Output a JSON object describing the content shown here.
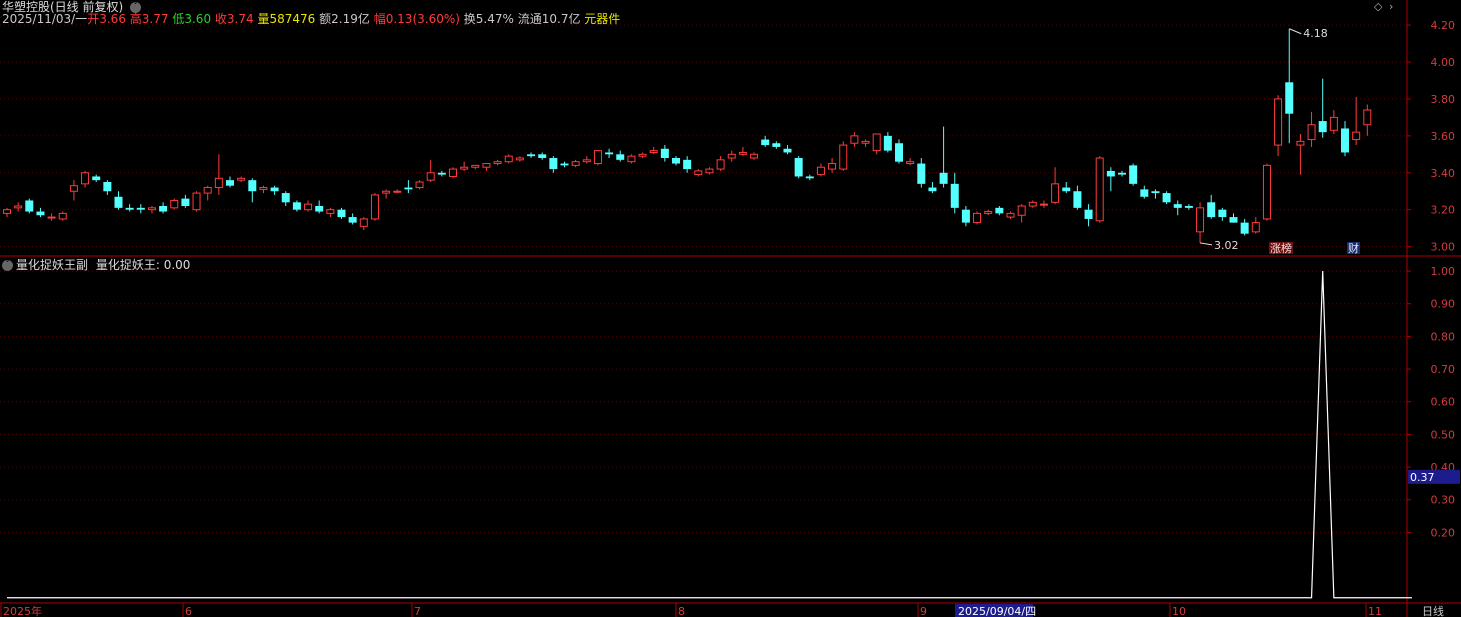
{
  "header": {
    "title": "华塑控股(日线 前复权)",
    "date": "2025/11/03/一",
    "open_label": "开",
    "open": "3.66",
    "high_label": "高",
    "high": "3.77",
    "low_label": "低",
    "low": "3.60",
    "close_label": "收",
    "close": "3.74",
    "vol_label": "量",
    "vol": "587476",
    "amt_label": "额",
    "amt": "2.19亿",
    "chg_label": "幅",
    "chg": "0.13(3.60%)",
    "turn_label": "换",
    "turn": "5.47%",
    "float_label": "流通",
    "float": "10.7亿",
    "sector": "元器件"
  },
  "indicator": {
    "title": "量化捉妖王副",
    "line_label": "量化捉妖王",
    "value": "0.00",
    "cursor_value": "0.37"
  },
  "badges": {
    "zhangting": "涨榜",
    "cai": "财"
  },
  "extremes": {
    "high_label": "4.18",
    "low_label": "3.02"
  },
  "footer": {
    "period": "日线",
    "cursor_date": "2025/09/04/四",
    "x_labels": [
      "2025年",
      "6",
      "7",
      "8",
      "9",
      "10",
      "11"
    ]
  },
  "colors": {
    "up": "#ff3b3b",
    "down": "#54ffff",
    "axis": "#b00000",
    "grid": "#5a0000",
    "text": "#c8c8c8"
  },
  "chart_data": [
    {
      "type": "candlestick",
      "y_ticks": [
        "3.00",
        "3.20",
        "3.40",
        "3.60",
        "3.80",
        "4.00",
        "4.20"
      ],
      "ylim": [
        2.96,
        4.26
      ],
      "candles": [
        [
          3.18,
          3.21,
          3.16,
          3.2
        ],
        [
          3.21,
          3.24,
          3.19,
          3.22
        ],
        [
          3.25,
          3.26,
          3.18,
          3.19
        ],
        [
          3.19,
          3.21,
          3.16,
          3.17
        ],
        [
          3.16,
          3.18,
          3.14,
          3.16
        ],
        [
          3.15,
          3.19,
          3.14,
          3.18
        ],
        [
          3.3,
          3.36,
          3.25,
          3.33
        ],
        [
          3.34,
          3.41,
          3.32,
          3.4
        ],
        [
          3.38,
          3.39,
          3.35,
          3.36
        ],
        [
          3.35,
          3.36,
          3.28,
          3.3
        ],
        [
          3.27,
          3.3,
          3.2,
          3.21
        ],
        [
          3.21,
          3.23,
          3.19,
          3.2
        ],
        [
          3.21,
          3.23,
          3.18,
          3.2
        ],
        [
          3.2,
          3.22,
          3.18,
          3.21
        ],
        [
          3.22,
          3.24,
          3.18,
          3.19
        ],
        [
          3.21,
          3.26,
          3.2,
          3.25
        ],
        [
          3.26,
          3.28,
          3.21,
          3.22
        ],
        [
          3.2,
          3.3,
          3.19,
          3.29
        ],
        [
          3.29,
          3.33,
          3.25,
          3.32
        ],
        [
          3.32,
          3.5,
          3.28,
          3.37
        ],
        [
          3.36,
          3.38,
          3.32,
          3.33
        ],
        [
          3.36,
          3.38,
          3.35,
          3.37
        ],
        [
          3.36,
          3.37,
          3.24,
          3.3
        ],
        [
          3.31,
          3.33,
          3.29,
          3.32
        ],
        [
          3.32,
          3.33,
          3.28,
          3.3
        ],
        [
          3.29,
          3.3,
          3.22,
          3.24
        ],
        [
          3.24,
          3.25,
          3.19,
          3.2
        ],
        [
          3.2,
          3.25,
          3.19,
          3.23
        ],
        [
          3.22,
          3.25,
          3.18,
          3.19
        ],
        [
          3.18,
          3.21,
          3.16,
          3.2
        ],
        [
          3.2,
          3.21,
          3.15,
          3.16
        ],
        [
          3.16,
          3.18,
          3.12,
          3.13
        ],
        [
          3.11,
          3.16,
          3.09,
          3.15
        ],
        [
          3.15,
          3.29,
          3.14,
          3.28
        ],
        [
          3.29,
          3.31,
          3.26,
          3.3
        ],
        [
          3.3,
          3.31,
          3.29,
          3.3
        ],
        [
          3.32,
          3.36,
          3.29,
          3.31
        ],
        [
          3.32,
          3.36,
          3.31,
          3.35
        ],
        [
          3.36,
          3.47,
          3.35,
          3.4
        ],
        [
          3.4,
          3.41,
          3.38,
          3.39
        ],
        [
          3.38,
          3.43,
          3.37,
          3.42
        ],
        [
          3.42,
          3.46,
          3.41,
          3.43
        ],
        [
          3.43,
          3.44,
          3.42,
          3.44
        ],
        [
          3.43,
          3.45,
          3.41,
          3.45
        ],
        [
          3.45,
          3.47,
          3.44,
          3.46
        ],
        [
          3.46,
          3.5,
          3.45,
          3.49
        ],
        [
          3.47,
          3.49,
          3.46,
          3.48
        ],
        [
          3.5,
          3.51,
          3.48,
          3.49
        ],
        [
          3.5,
          3.51,
          3.47,
          3.48
        ],
        [
          3.48,
          3.49,
          3.4,
          3.42
        ],
        [
          3.45,
          3.46,
          3.43,
          3.44
        ],
        [
          3.44,
          3.47,
          3.43,
          3.46
        ],
        [
          3.46,
          3.49,
          3.45,
          3.47
        ],
        [
          3.45,
          3.52,
          3.44,
          3.52
        ],
        [
          3.51,
          3.53,
          3.48,
          3.5
        ],
        [
          3.5,
          3.52,
          3.46,
          3.47
        ],
        [
          3.46,
          3.5,
          3.45,
          3.49
        ],
        [
          3.49,
          3.51,
          3.48,
          3.5
        ],
        [
          3.51,
          3.54,
          3.5,
          3.52
        ],
        [
          3.53,
          3.55,
          3.46,
          3.48
        ],
        [
          3.48,
          3.49,
          3.44,
          3.45
        ],
        [
          3.47,
          3.49,
          3.4,
          3.42
        ],
        [
          3.39,
          3.42,
          3.38,
          3.41
        ],
        [
          3.4,
          3.43,
          3.39,
          3.42
        ],
        [
          3.42,
          3.49,
          3.41,
          3.47
        ],
        [
          3.48,
          3.52,
          3.46,
          3.5
        ],
        [
          3.5,
          3.54,
          3.49,
          3.51
        ],
        [
          3.48,
          3.51,
          3.47,
          3.5
        ],
        [
          3.58,
          3.6,
          3.54,
          3.55
        ],
        [
          3.56,
          3.57,
          3.53,
          3.54
        ],
        [
          3.53,
          3.55,
          3.5,
          3.51
        ],
        [
          3.48,
          3.49,
          3.37,
          3.38
        ],
        [
          3.38,
          3.39,
          3.36,
          3.37
        ],
        [
          3.39,
          3.45,
          3.38,
          3.43
        ],
        [
          3.42,
          3.48,
          3.4,
          3.45
        ],
        [
          3.42,
          3.57,
          3.41,
          3.55
        ],
        [
          3.56,
          3.62,
          3.54,
          3.6
        ],
        [
          3.56,
          3.58,
          3.54,
          3.57
        ],
        [
          3.52,
          3.61,
          3.5,
          3.61
        ],
        [
          3.6,
          3.62,
          3.51,
          3.52
        ],
        [
          3.56,
          3.58,
          3.45,
          3.46
        ],
        [
          3.45,
          3.48,
          3.44,
          3.46
        ],
        [
          3.45,
          3.48,
          3.32,
          3.34
        ],
        [
          3.32,
          3.35,
          3.29,
          3.3
        ],
        [
          3.4,
          3.65,
          3.32,
          3.34
        ],
        [
          3.34,
          3.4,
          3.18,
          3.21
        ],
        [
          3.2,
          3.22,
          3.11,
          3.13
        ],
        [
          3.13,
          3.19,
          3.12,
          3.18
        ],
        [
          3.18,
          3.2,
          3.17,
          3.19
        ],
        [
          3.21,
          3.22,
          3.17,
          3.18
        ],
        [
          3.16,
          3.19,
          3.15,
          3.18
        ],
        [
          3.17,
          3.23,
          3.13,
          3.22
        ],
        [
          3.22,
          3.25,
          3.21,
          3.24
        ],
        [
          3.23,
          3.25,
          3.21,
          3.23
        ],
        [
          3.24,
          3.43,
          3.23,
          3.34
        ],
        [
          3.32,
          3.35,
          3.29,
          3.3
        ],
        [
          3.3,
          3.33,
          3.2,
          3.21
        ],
        [
          3.2,
          3.23,
          3.11,
          3.15
        ],
        [
          3.14,
          3.49,
          3.13,
          3.48
        ],
        [
          3.41,
          3.43,
          3.3,
          3.38
        ],
        [
          3.4,
          3.41,
          3.38,
          3.39
        ],
        [
          3.44,
          3.45,
          3.33,
          3.34
        ],
        [
          3.31,
          3.33,
          3.26,
          3.27
        ],
        [
          3.3,
          3.31,
          3.26,
          3.29
        ],
        [
          3.29,
          3.3,
          3.23,
          3.24
        ],
        [
          3.23,
          3.25,
          3.17,
          3.21
        ],
        [
          3.22,
          3.23,
          3.2,
          3.21
        ],
        [
          3.08,
          3.24,
          3.02,
          3.21
        ],
        [
          3.24,
          3.28,
          3.15,
          3.16
        ],
        [
          3.2,
          3.21,
          3.14,
          3.16
        ],
        [
          3.16,
          3.18,
          3.13,
          3.13
        ],
        [
          3.13,
          3.15,
          3.06,
          3.07
        ],
        [
          3.08,
          3.16,
          3.07,
          3.13
        ],
        [
          3.15,
          3.45,
          3.14,
          3.44
        ],
        [
          3.55,
          3.82,
          3.49,
          3.8
        ],
        [
          3.89,
          4.18,
          3.56,
          3.72
        ],
        [
          3.55,
          3.61,
          3.39,
          3.57
        ],
        [
          3.58,
          3.73,
          3.54,
          3.66
        ],
        [
          3.68,
          3.91,
          3.59,
          3.62
        ],
        [
          3.63,
          3.74,
          3.61,
          3.7
        ],
        [
          3.64,
          3.68,
          3.49,
          3.51
        ],
        [
          3.58,
          3.81,
          3.55,
          3.62
        ],
        [
          3.66,
          3.77,
          3.6,
          3.74
        ]
      ]
    },
    {
      "type": "line",
      "series_name": "量化捉妖王",
      "y_ticks": [
        "0.20",
        "0.30",
        "0.40",
        "0.50",
        "0.60",
        "0.70",
        "0.80",
        "0.90",
        "1.00"
      ],
      "ylim": [
        -0.01,
        1.04
      ],
      "values": [
        0,
        0,
        0,
        0,
        0,
        0,
        0,
        0,
        0,
        0,
        0,
        0,
        0,
        0,
        0,
        0,
        0,
        0,
        0,
        0,
        0,
        0,
        0,
        0,
        0,
        0,
        0,
        0,
        0,
        0,
        0,
        0,
        0,
        0,
        0,
        0,
        0,
        0,
        0,
        0,
        0,
        0,
        0,
        0,
        0,
        0,
        0,
        0,
        0,
        0,
        0,
        0,
        0,
        0,
        0,
        0,
        0,
        0,
        0,
        0,
        0,
        0,
        0,
        0,
        0,
        0,
        0,
        0,
        0,
        0,
        0,
        0,
        0,
        0,
        0,
        0,
        0,
        0,
        0,
        0,
        0,
        0,
        0,
        0,
        0,
        0,
        0,
        0,
        0,
        0,
        0,
        0,
        0,
        0,
        0,
        0,
        0,
        0,
        0,
        0,
        0,
        0,
        0,
        0,
        0,
        0,
        0,
        0,
        0,
        0,
        0,
        0,
        0,
        0,
        0,
        0,
        0,
        0,
        1,
        0,
        0,
        0,
        0,
        0,
        0,
        0,
        0
      ]
    }
  ]
}
